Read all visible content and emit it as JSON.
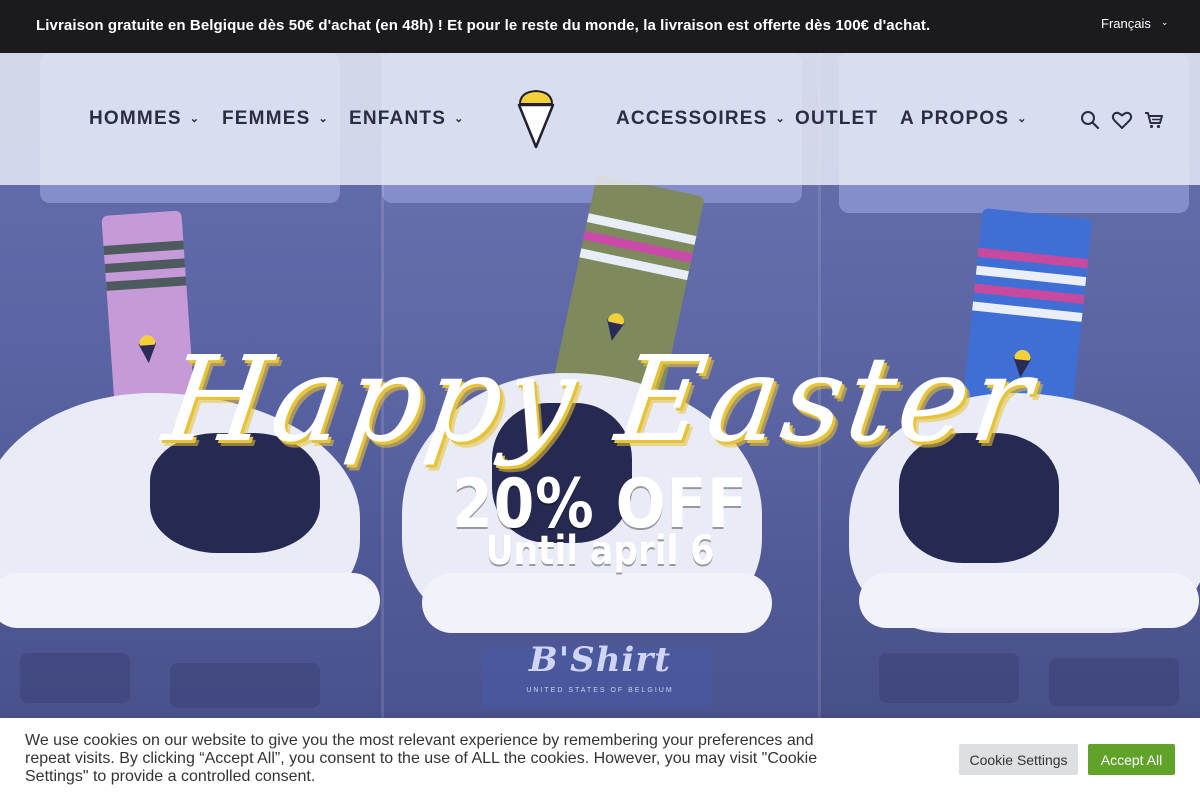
{
  "topbar": {
    "message": "Livraison gratuite en Belgique dès 50€ d'achat (en 48h) ! Et pour le reste du monde, la livraison est offerte dès 100€ d'achat.",
    "language": "Français"
  },
  "nav": {
    "items": [
      {
        "label": "HOMMES",
        "has_dropdown": true
      },
      {
        "label": "FEMMES",
        "has_dropdown": true
      },
      {
        "label": "ENFANTS",
        "has_dropdown": true
      },
      {
        "label": "ACCESSOIRES",
        "has_dropdown": true
      },
      {
        "label": "OUTLET",
        "has_dropdown": false
      },
      {
        "label": "A PROPOS",
        "has_dropdown": true
      }
    ],
    "icons": [
      "search-icon",
      "heart-icon",
      "cart-icon",
      "logo-cone-icon",
      "chevron-down-icon"
    ]
  },
  "hero": {
    "headline": "Happy Easter",
    "offer": "20% OFF",
    "until": "Until april 6",
    "brand": "B'Shirt",
    "brand_sub": "UNITED STATES OF BELGIUM"
  },
  "cookie": {
    "text": "We use cookies on our website to give you the most relevant experience by remembering your preferences and repeat visits. By clicking “Accept All”, you consent to the use of ALL the cookies. However, you may visit \"Cookie Settings\" to provide a controlled consent.",
    "settings_label": "Cookie Settings",
    "accept_label": "Accept All"
  },
  "colors": {
    "topbar_bg": "#1b1b1d",
    "nav_text": "#2a2d44",
    "hero_overlay": "#57609e",
    "accept_green": "#61a229",
    "logo_yellow": "#f3cf3a"
  }
}
